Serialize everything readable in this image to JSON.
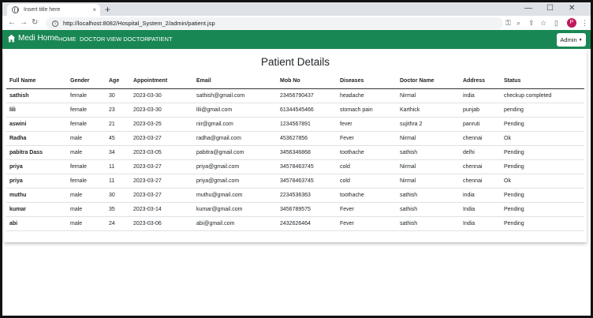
{
  "browser": {
    "tab_title": "Insert title here",
    "tab_close": "×",
    "new_tab": "+",
    "minimize": "—",
    "maximize": "☐",
    "close": "✕",
    "url": "http://localhost:8082/Hospital_System_2/admin/patient.jsp",
    "profile_initial": "P",
    "icons": [
      "key-icon",
      "zoom-icon",
      "share-icon",
      "star-icon",
      "sidebar-icon",
      "profile-avatar",
      "menu-icon"
    ]
  },
  "navbar": {
    "brand": "Medi Home",
    "links": [
      "HOME",
      "DOCTOR",
      "VIEW DOCTOR",
      "PATIENT"
    ],
    "admin_label": "Admin",
    "color": "#198754"
  },
  "page": {
    "title": "Patient Details"
  },
  "table": {
    "columns": [
      "Full Name",
      "Gender",
      "Age",
      "Appointment",
      "Email",
      "Mob No",
      "Diseases",
      "Doctor Name",
      "Address",
      "Status"
    ],
    "rows": [
      [
        "sathish",
        "female",
        "30",
        "2023-03-30",
        "sathish@gmail.com",
        "23456790437",
        "headache",
        "Nirmal",
        "india",
        "checkup completed"
      ],
      [
        "lili",
        "female",
        "23",
        "2023-03-30",
        "lili@gmail.com",
        "61344545466",
        "stomach pain",
        "Karthick",
        "punjab",
        "pending"
      ],
      [
        "aswini",
        "female",
        "21",
        "2023-03-25",
        "nir@gmail.com",
        "1234567891",
        "fever",
        "sujithra 2",
        "panruti",
        "Pending"
      ],
      [
        "Radha",
        "male",
        "45",
        "2023-03-27",
        "radha@gmail.com",
        "453627856",
        "Fever",
        "Nirmal",
        "chennai",
        "Ok"
      ],
      [
        "pabitra Dass",
        "male",
        "34",
        "2023-03-05",
        "pabitra@gmail.com",
        "3456346868",
        "toothache",
        "sathish",
        "delhi",
        "Pending"
      ],
      [
        "priya",
        "female",
        "11",
        "2023-03-27",
        "priya@gmail.com",
        "34578463745",
        "cold",
        "Nirmal",
        "chennai",
        "Pending"
      ],
      [
        "priya",
        "female",
        "11",
        "2023-03-27",
        "priya@gmail.com",
        "34578463745",
        "cold",
        "Nirmal",
        "chennai",
        "Ok"
      ],
      [
        "muthu",
        "male",
        "30",
        "2023-03-27",
        "muthu@gmail.com",
        "2234536363",
        "toothache",
        "sathish",
        "india",
        "Pending"
      ],
      [
        "kumar",
        "male",
        "35",
        "2023-03-14",
        "kumar@gmail.com",
        "3456789575",
        "Fever",
        "sathish",
        "India",
        "Pending"
      ],
      [
        "abi",
        "male",
        "24",
        "2023-03-06",
        "abi@gmail.com",
        "2432626464",
        "Fever",
        "sathish",
        "India",
        "Pending"
      ]
    ]
  }
}
